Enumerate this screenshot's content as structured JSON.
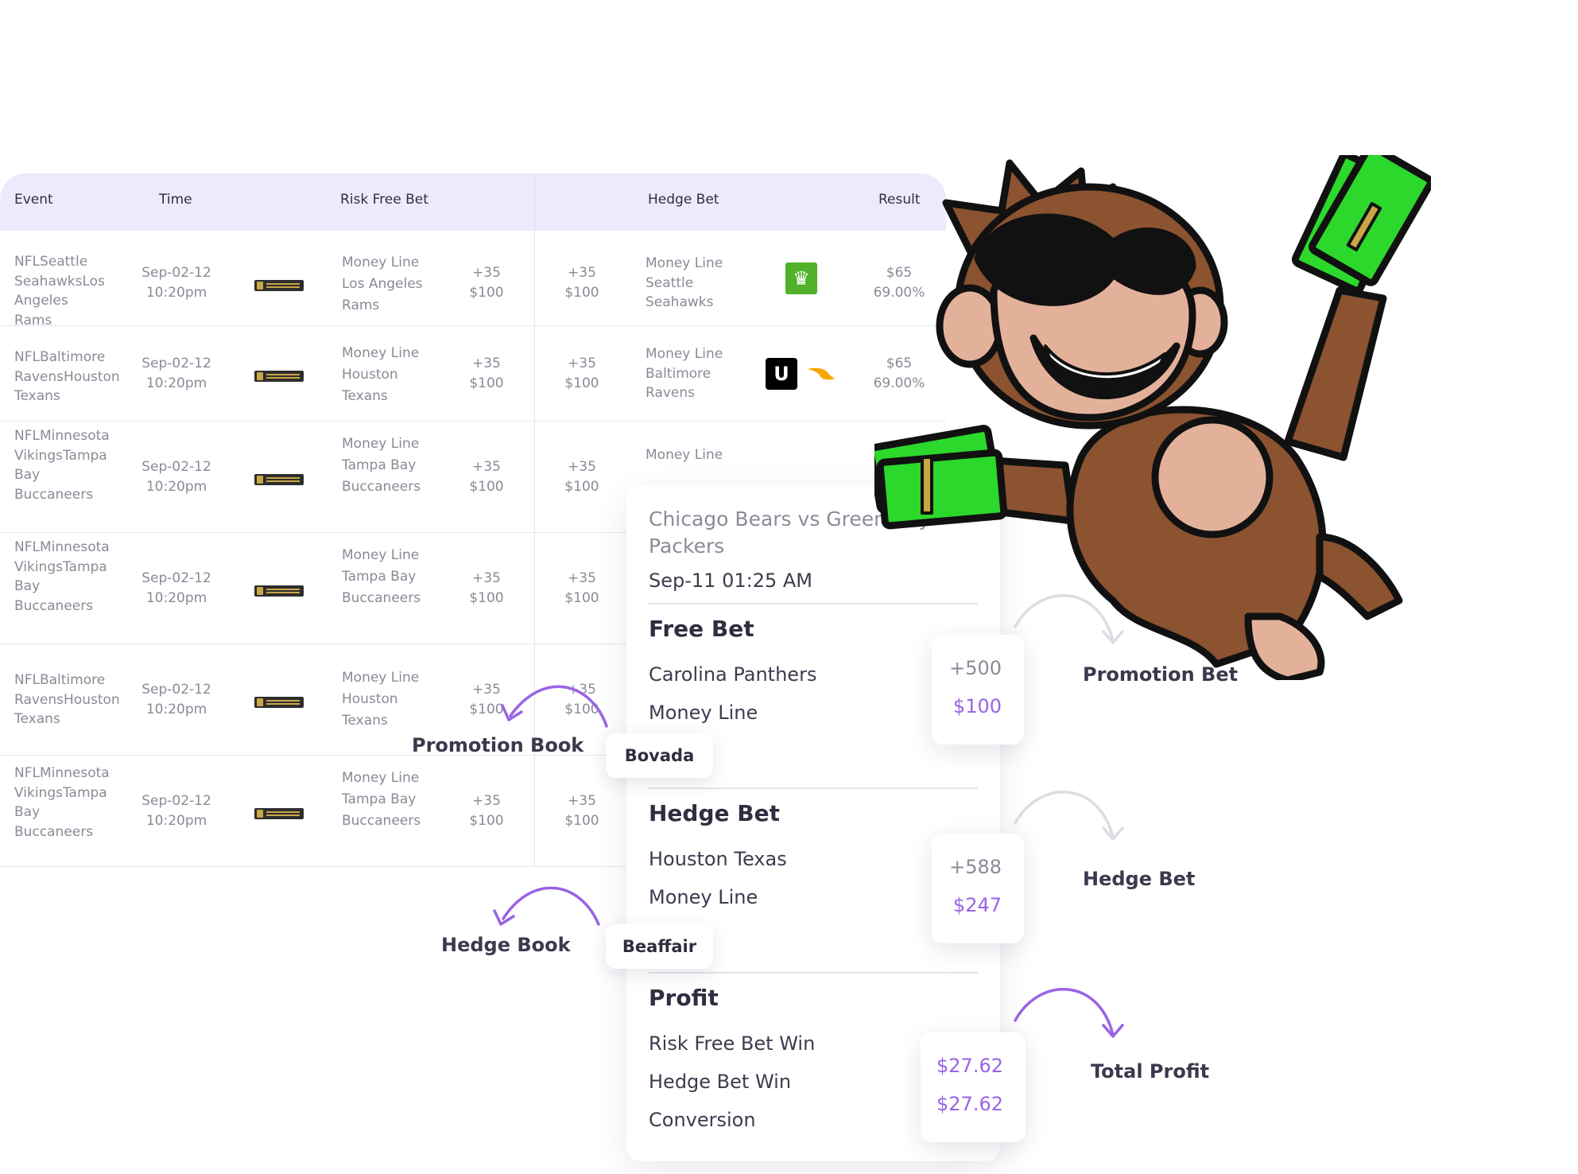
{
  "table": {
    "headers": {
      "event": "Event",
      "time": "Time",
      "risk_free_bet": "Risk Free Bet",
      "hedge_bet": "Hedge Bet",
      "result": "Result"
    },
    "rows": [
      {
        "event": "NFLSeattle SeahawksLos Angeles Rams",
        "date": "Sep-02-12",
        "time": "10:20pm",
        "book": "caesars-sportsbook-logo",
        "line_type": "Money Line",
        "team": "Los Angeles Rams",
        "odds1": "+35",
        "stake1": "$100",
        "odds2": "+35",
        "stake2": "$100",
        "hedge_type": "Money Line",
        "hedge_team": "Seattle Seahawks",
        "hedge_logo": "draftkings-logo",
        "result": "$65",
        "result_pct": "69.00%"
      },
      {
        "event": "NFLBaltimore RavensHouston Texans",
        "date": "Sep-02-12",
        "time": "10:20pm",
        "book": "caesars-sportsbook-logo",
        "line_type": "Money Line",
        "team": "Houston Texans",
        "odds1": "+35",
        "stake1": "$100",
        "odds2": "+35",
        "stake2": "$100",
        "hedge_type": "Money Line",
        "hedge_team": "Baltimore Ravens",
        "hedge_logo": "unibet-logo",
        "result": "$65",
        "result_pct": "69.00%"
      },
      {
        "event": "NFLMinnesota VikingsTampa Bay Buccaneers",
        "date": "Sep-02-12",
        "time": "10:20pm",
        "book": "caesars-sportsbook-logo",
        "line_type": "Money Line",
        "team": "Tampa Bay Buccaneers",
        "odds1": "+35",
        "stake1": "$100",
        "odds2": "+35",
        "stake2": "$100",
        "hedge_type": "Money Line"
      },
      {
        "event": "NFLMinnesota VikingsTampa Bay Buccaneers",
        "date": "Sep-02-12",
        "time": "10:20pm",
        "book": "caesars-sportsbook-logo",
        "line_type": "Money Line",
        "team": "Tampa Bay Buccaneers",
        "odds1": "+35",
        "stake1": "$100",
        "odds2": "+35",
        "stake2": "$100"
      },
      {
        "event": "NFLBaltimore RavensHouston Texans",
        "date": "Sep-02-12",
        "time": "10:20pm",
        "book": "caesars-sportsbook-logo",
        "line_type": "Money Line",
        "team": "Houston Texans",
        "odds1": "+35",
        "stake1": "$100",
        "odds2": "+35",
        "stake2": "$100"
      },
      {
        "event": "NFLMinnesota VikingsTampa Bay Buccaneers",
        "date": "Sep-02-12",
        "time": "10:20pm",
        "book": "caesars-sportsbook-logo",
        "line_type": "Money Line",
        "team": "Tampa Bay Buccaneers",
        "odds1": "+35",
        "stake1": "$100",
        "odds2": "+35",
        "stake2": "$100"
      }
    ]
  },
  "card": {
    "title": "Chicago Bears vs Green Bay Packers",
    "datetime": "Sep-11 01:25 AM",
    "free_bet": {
      "heading": "Free Bet",
      "team": "Carolina Panthers",
      "line": "Money Line",
      "odds": "+500",
      "stake": "$100"
    },
    "hedge_bet": {
      "heading": "Hedge Bet",
      "team": "Houston Texas",
      "line": "Money Line",
      "odds": "+588",
      "stake": "$247"
    },
    "profit": {
      "heading": "Profit",
      "risk_free_win": "Risk Free Bet Win",
      "hedge_win": "Hedge Bet Win",
      "conversion": "Conversion",
      "value1": "$27.62",
      "value2": "$27.62"
    }
  },
  "tags": {
    "promotion_book": "Bovada",
    "hedge_book": "Beaffair"
  },
  "labels": {
    "promotion_book": "Promotion Book",
    "hedge_book": "Hedge Book",
    "promotion_bet": "Promotion Bet",
    "hedge_bet": "Hedge Bet",
    "total_profit": "Total Profit"
  },
  "colors": {
    "accent": "#9a63e6",
    "header_bg": "#efe9fd",
    "draftkings": "#4fb22a",
    "money": "#2cd82c"
  },
  "icons": {
    "mascot": "monkey-mascot-with-money"
  }
}
